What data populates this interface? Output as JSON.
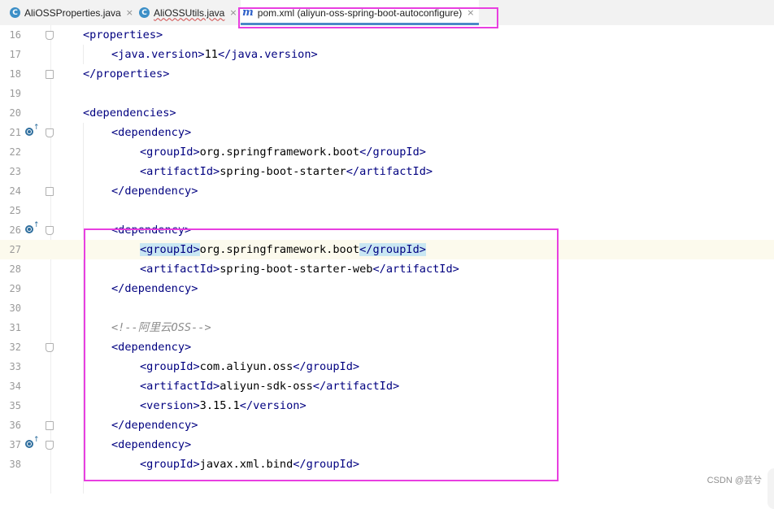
{
  "tabs": [
    {
      "label": "AliOSSProperties.java",
      "icon": "java-class-icon",
      "icon_glyph": "C"
    },
    {
      "label": "AliOSSUtils.java",
      "icon": "java-class-icon",
      "icon_glyph": "C"
    },
    {
      "label": "pom.xml (aliyun-oss-spring-boot-autoconfigure)",
      "icon": "maven-icon",
      "icon_glyph": "m"
    }
  ],
  "close_glyph": "×",
  "lines": [
    {
      "num": "16",
      "open": "<properties>"
    },
    {
      "num": "17",
      "open": "<java.version>",
      "text": "11",
      "close": "</java.version>"
    },
    {
      "num": "18",
      "close": "</properties>"
    },
    {
      "num": "19"
    },
    {
      "num": "20",
      "open": "<dependencies>"
    },
    {
      "num": "21",
      "open": "<dependency>"
    },
    {
      "num": "22",
      "open": "<groupId>",
      "text": "org.springframework.boot",
      "close": "</groupId>"
    },
    {
      "num": "23",
      "open": "<artifactId>",
      "text": "spring-boot-starter",
      "close": "</artifactId>"
    },
    {
      "num": "24",
      "close": "</dependency>"
    },
    {
      "num": "25"
    },
    {
      "num": "26",
      "open": "<dependency>"
    },
    {
      "num": "27",
      "open": "<groupId>",
      "text": "org.springframework.boot",
      "close": "</groupId>"
    },
    {
      "num": "28",
      "open": "<artifactId>",
      "text": "spring-boot-starter-web",
      "close": "</artifactId>"
    },
    {
      "num": "29",
      "close": "</dependency>"
    },
    {
      "num": "30"
    },
    {
      "num": "31",
      "comment": "<!--阿里云OSS-->"
    },
    {
      "num": "32",
      "open": "<dependency>"
    },
    {
      "num": "33",
      "open": "<groupId>",
      "text": "com.aliyun.oss",
      "close": "</groupId>"
    },
    {
      "num": "34",
      "open": "<artifactId>",
      "text": "aliyun-sdk-oss",
      "close": "</artifactId>"
    },
    {
      "num": "35",
      "open": "<version>",
      "text": "3.15.1",
      "close": "</version>"
    },
    {
      "num": "36",
      "close": "</dependency>"
    },
    {
      "num": "37",
      "open": "<dependency>"
    },
    {
      "num": "38",
      "open": "<groupId>",
      "text": "javax.xml.bind",
      "close": "</groupId>"
    }
  ],
  "current_line": "27",
  "watermark": "CSDN @芸兮",
  "colors": {
    "tag": "#000080",
    "comment": "#8c8c8c",
    "annotation": "#e83fe0",
    "highlight": "#c9e7f2",
    "current_line": "#fcfaed"
  }
}
